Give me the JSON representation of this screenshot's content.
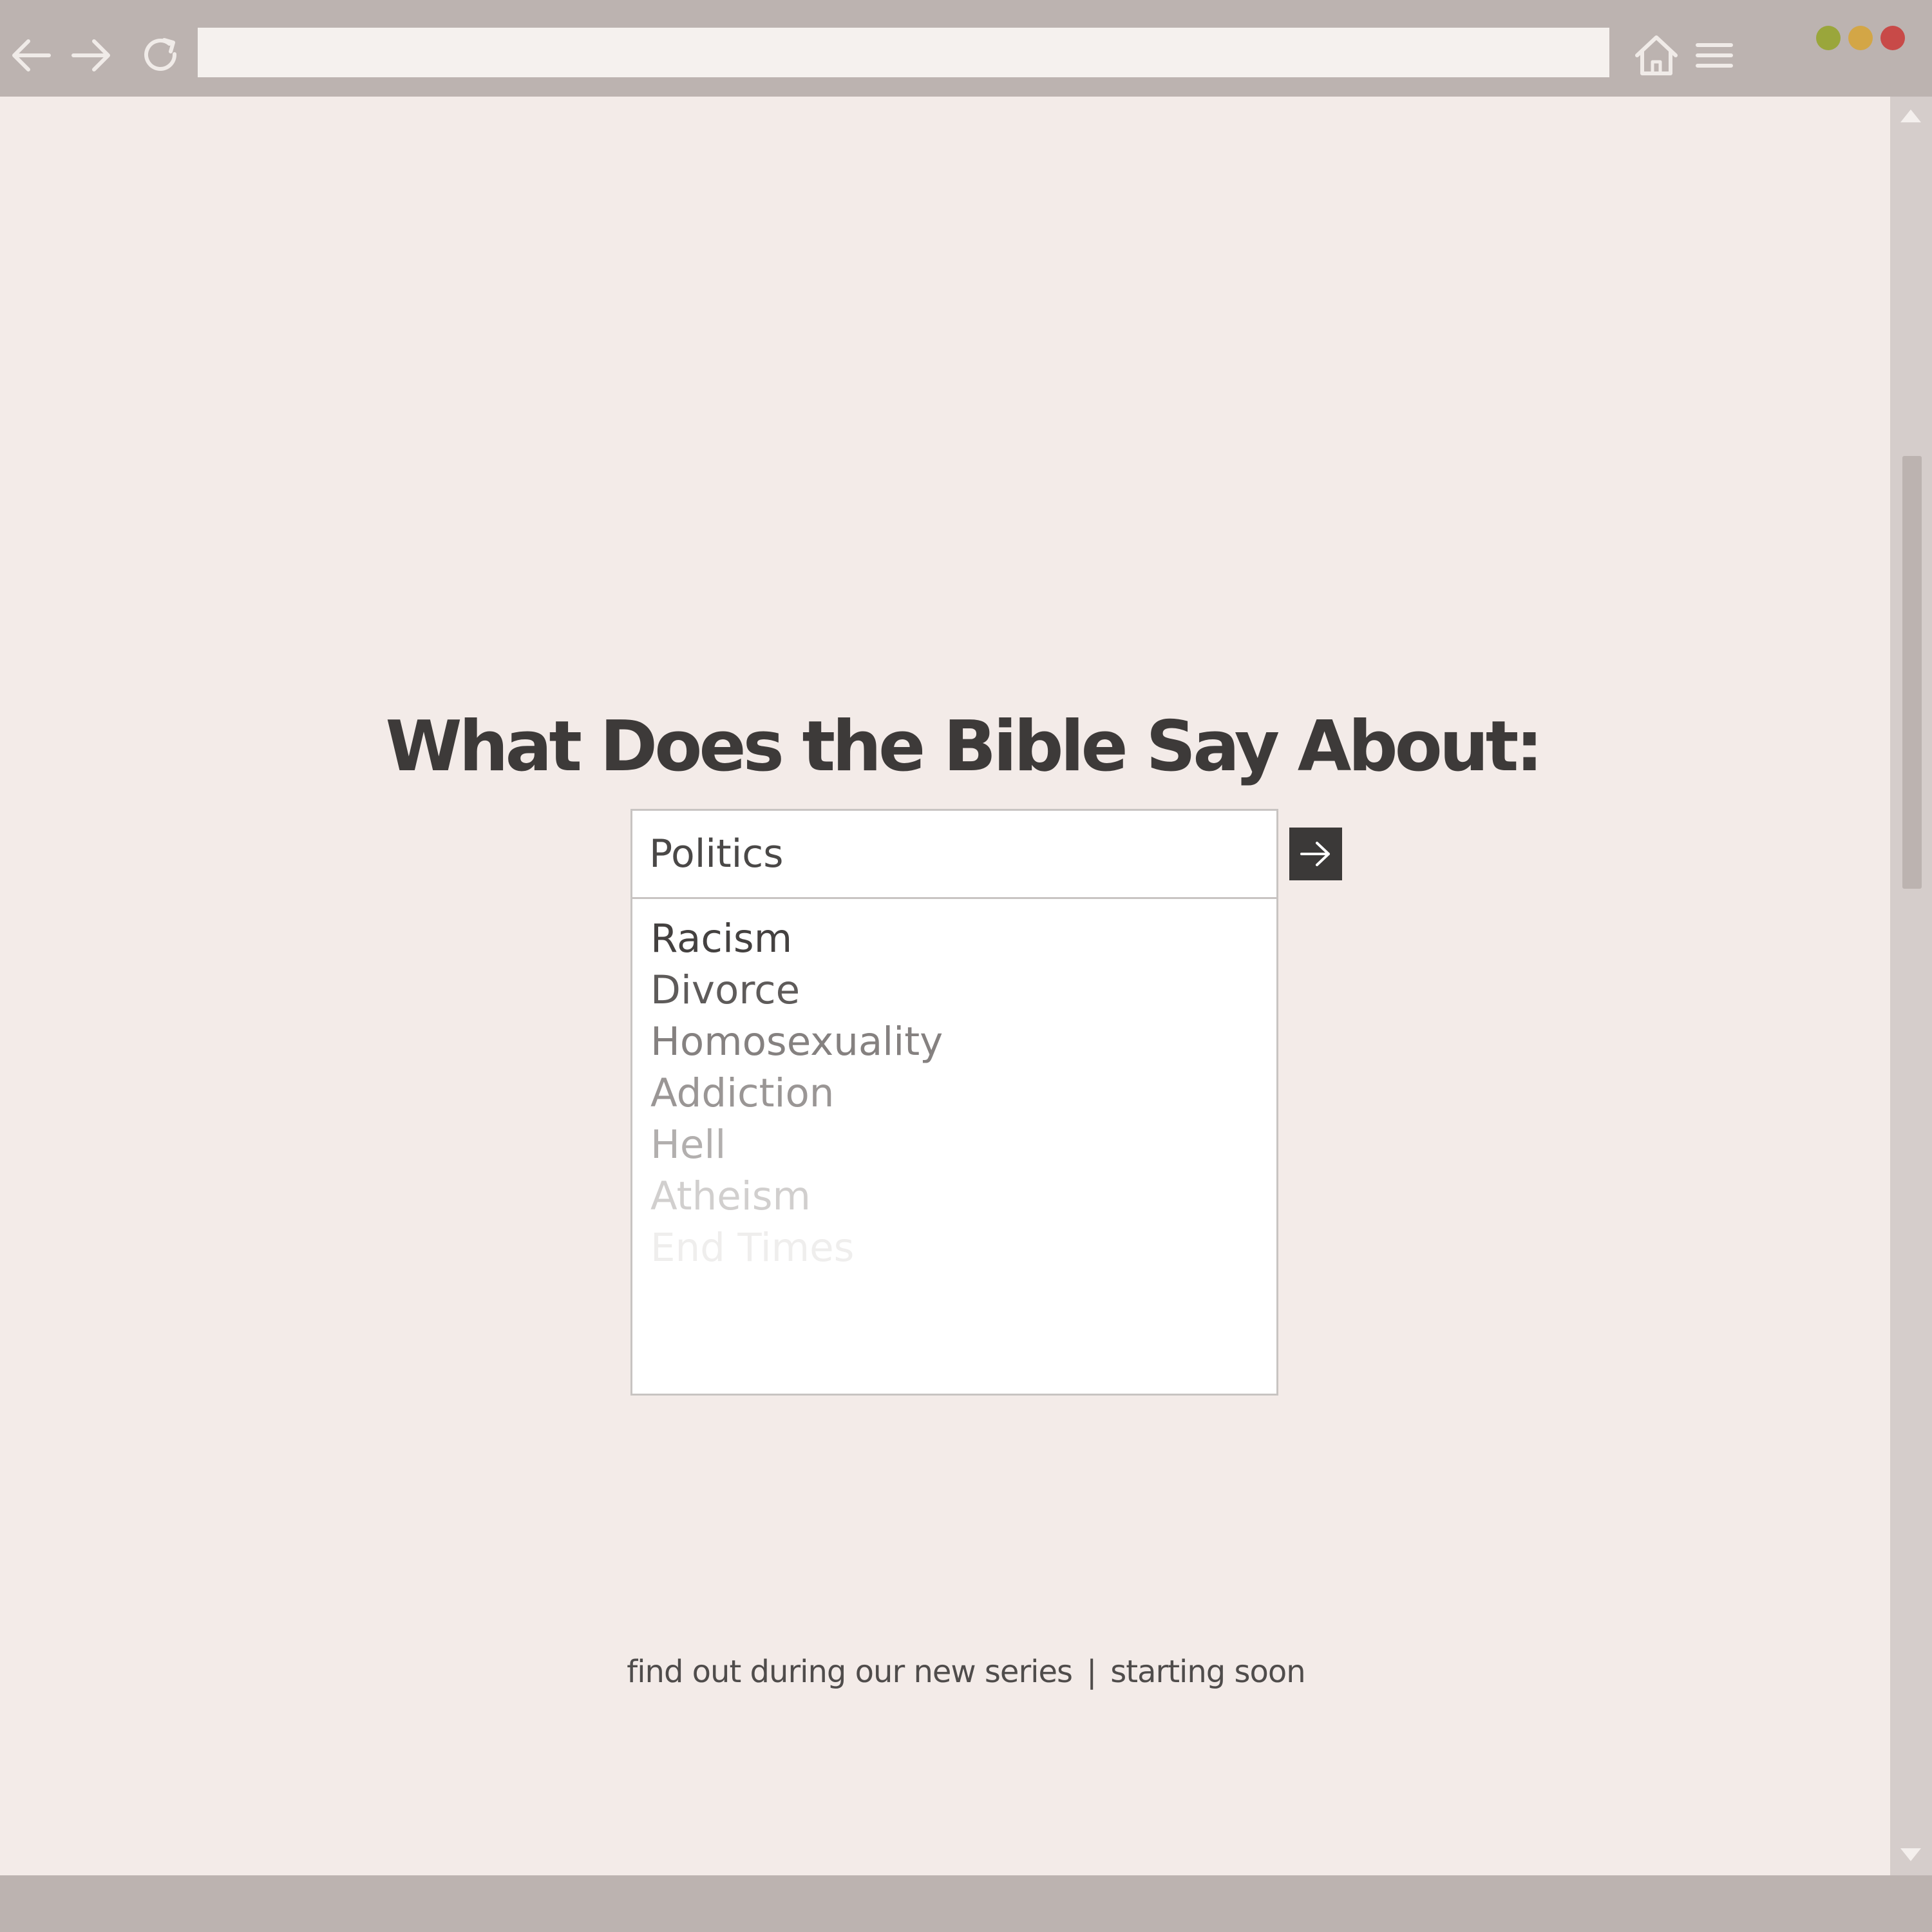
{
  "browser": {
    "address_bar": {
      "value": ""
    },
    "icons": {
      "back": "back-arrow-icon",
      "forward": "forward-arrow-icon",
      "reload": "reload-icon",
      "home": "home-icon",
      "menu": "hamburger-menu-icon"
    },
    "window_controls": [
      {
        "name": "minimize",
        "color": "#9aa63b"
      },
      {
        "name": "maximize",
        "color": "#d3a646"
      },
      {
        "name": "close",
        "color": "#c84a48"
      }
    ],
    "colors": {
      "chrome": "#bcb3b0",
      "page_background": "#f3ebe8",
      "scrollbar_track": "#d5cdcb"
    }
  },
  "page": {
    "headline": "What Does the Bible Say About:",
    "search": {
      "value": "Politics",
      "go_icon": "right-arrow-icon"
    },
    "suggestions": [
      {
        "label": "Racism",
        "color": "#444140"
      },
      {
        "label": "Divorce",
        "color": "#5e5b5a"
      },
      {
        "label": "Homosexuality",
        "color": "#858180"
      },
      {
        "label": "Addiction",
        "color": "#9a9695"
      },
      {
        "label": "Hell",
        "color": "#b2afae"
      },
      {
        "label": "Atheism",
        "color": "#d1cfce"
      },
      {
        "label": "End Times",
        "color": "#efeeed"
      }
    ],
    "tagline": {
      "left": "find out during our new series",
      "separator": "|",
      "right": "starting soon"
    }
  }
}
